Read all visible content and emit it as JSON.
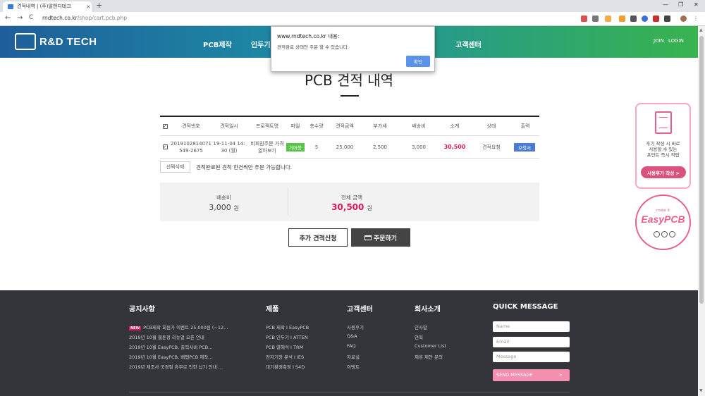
{
  "browser": {
    "tab_title": "견적내역 | (주)알앤디테크",
    "tab_close": "×",
    "new_tab": "+",
    "win_min": "—",
    "win_max": "❐",
    "win_close": "✕",
    "back": "←",
    "forward": "→",
    "reload": "C",
    "url_host": "rndtech.co.kr",
    "url_path": "/shop/cart.pcb.php"
  },
  "header": {
    "logo": "R&D TECH",
    "nav": [
      "PCB제작",
      "인두기",
      "고객센터"
    ],
    "join": "JOIN",
    "login": "LOGIN"
  },
  "dialog": {
    "title": "www.rndtech.co.kr 내용:",
    "message": "견적완료 상태만 주문 할 수 있습니다.",
    "ok": "확인"
  },
  "page": {
    "title": "PCB 견적 내역"
  },
  "table": {
    "headers": [
      "견적번호",
      "견적일시",
      "프로젝트명",
      "파일",
      "총수량",
      "견적금액",
      "부가세",
      "배송비",
      "소계",
      "상태",
      "출력"
    ],
    "rows": [
      {
        "checkbox": "✓",
        "quote_no_1": "2019102814071",
        "quote_no_2": "549-2675",
        "date_1": "19-11-04 14:",
        "date_2": "30 (월)",
        "project_1": "비회원주문 가격",
        "project_2": "알아보기",
        "file": "거버봉",
        "qty": "5",
        "amount": "25,000",
        "vat": "2,500",
        "shipping": "3,000",
        "subtotal": "30,500",
        "status": "견적요청",
        "print": "요청서"
      }
    ],
    "header_checkbox": "✓"
  },
  "actions": {
    "delete_selected": "선택삭제",
    "note": "견적완료된 견적 한건씩만 주문 가능합니다.",
    "add_quote": "추가 견적신청",
    "order": "주문하기"
  },
  "summary": {
    "shipping_label": "배송비",
    "shipping_value": "3,000",
    "total_label": "전체 금액",
    "total_value": "30,500",
    "won": "원"
  },
  "side": {
    "review_line1": "후기 작성 시 바로",
    "review_line2": "사용할 수 있는",
    "review_line3": "포인트 즉시 적립",
    "review_btn": "사용후기 작성 >",
    "makeit": "make it",
    "easypcb": "EasyPCB"
  },
  "footer": {
    "notice": {
      "title": "공지사항",
      "new": "NEW",
      "items": [
        "PCB제작 회원가 이벤트 25,000원 (~12…",
        "2019년 10월 웹툰정 리뉴얼 오픈 안내",
        "2019년 10월 EasyPCB, 출력서비 PCB…",
        "2019년 10월 EasyPCB, 배탭PCB 제작…",
        "2019년 제조사 국경절 휴무로 인한 납기 안내 …"
      ]
    },
    "products": {
      "title": "제품",
      "items": [
        "PCB 제작 I EasyPCB",
        "PCB 인두기 I ATTEN",
        "PCB 열해석 I TRM",
        "전자기장 분석 I IES",
        "대기환경측정 I S4D"
      ]
    },
    "support": {
      "title": "고객센터",
      "items": [
        "사용후기",
        "Q&A",
        "FAQ",
        "자료실",
        "이벤트"
      ]
    },
    "company": {
      "title": "회사소개",
      "items": [
        "인사말",
        "연혁",
        "Customer List",
        "제휴 제안 문의"
      ]
    },
    "quick": {
      "title": "QUICK MESSAGE",
      "name": "Name",
      "email": "Email",
      "message": "Message",
      "send": "SEND MESSAGE",
      "arrow": ">"
    }
  },
  "colors": {
    "accent_pink": "#e0195e",
    "header_start": "#1e5e9b",
    "header_end": "#39b34e"
  }
}
